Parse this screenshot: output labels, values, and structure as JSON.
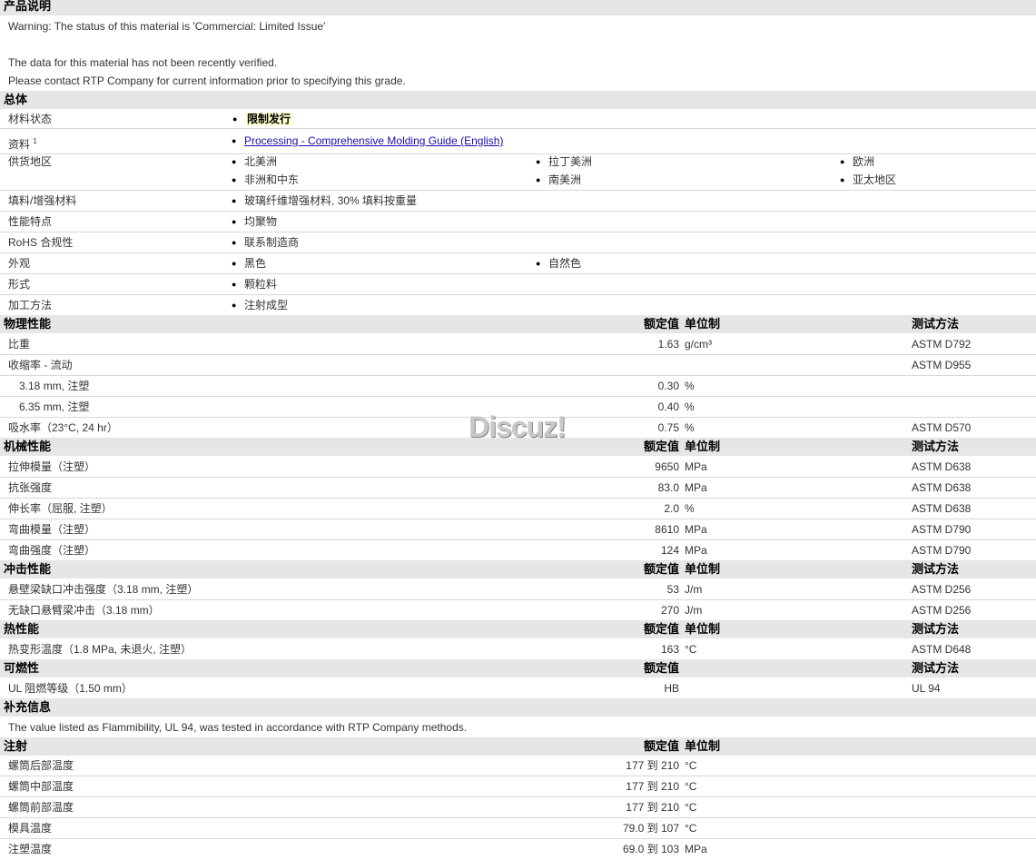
{
  "sections": {
    "desc": "产品说明",
    "general": "总体",
    "physical": "物理性能",
    "mechanical": "机械性能",
    "impact": "冲击性能",
    "thermal": "热性能",
    "flammability": "可燃性",
    "additional": "补充信息",
    "injection": "注射"
  },
  "headers": {
    "value": "额定值",
    "unit": "单位制",
    "method": "测试方法"
  },
  "description": {
    "warning": "Warning: The status of this material is 'Commercial: Limited Issue'",
    "line2": "The data for this material has not been recently verified.",
    "line3": "Please contact RTP Company for current information prior to specifying this grade."
  },
  "general": {
    "status_label": "材料状态",
    "status_value": "限制发行",
    "docs_label": "资料",
    "docs_sup": "1",
    "docs_link": "Processing - Comprehensive Molding Guide (English)",
    "supply_label": "供货地区",
    "supply": [
      "北美洲",
      "拉丁美洲",
      "欧洲",
      "非洲和中东",
      "南美洲",
      "亚太地区"
    ],
    "filler_label": "填料/增强材料",
    "filler_value": "玻璃纤维增强材料, 30% 填料按重量",
    "feature_label": "性能特点",
    "feature_value": "均聚物",
    "rohs_label": "RoHS 合规性",
    "rohs_value": "联系制造商",
    "appearance_label": "外观",
    "appearance": [
      "黑色",
      "自然色"
    ],
    "form_label": "形式",
    "form_value": "颗粒料",
    "process_label": "加工方法",
    "process_value": "注射成型"
  },
  "physical": [
    {
      "label": "比重",
      "value": "1.63",
      "unit": "g/cm³",
      "method": "ASTM D792"
    },
    {
      "label": "收缩率  - 流动",
      "value": "",
      "unit": "",
      "method": "ASTM D955"
    },
    {
      "label": "3.18 mm, 注塑",
      "value": "0.30",
      "unit": "%",
      "method": ""
    },
    {
      "label": "6.35 mm, 注塑",
      "value": "0.40",
      "unit": "%",
      "method": ""
    },
    {
      "label": "吸水率（23°C, 24 hr）",
      "value": "0.75",
      "unit": "%",
      "method": "ASTM D570"
    }
  ],
  "mechanical": [
    {
      "label": "拉伸模量（注塑）",
      "value": "9650",
      "unit": "MPa",
      "method": "ASTM D638"
    },
    {
      "label": "抗张强度",
      "value": "83.0",
      "unit": "MPa",
      "method": "ASTM D638"
    },
    {
      "label": "伸长率（屈服, 注塑）",
      "value": "2.0",
      "unit": "%",
      "method": "ASTM D638"
    },
    {
      "label": "弯曲模量（注塑）",
      "value": "8610",
      "unit": "MPa",
      "method": "ASTM D790"
    },
    {
      "label": "弯曲强度（注塑）",
      "value": "124",
      "unit": "MPa",
      "method": "ASTM D790"
    }
  ],
  "impact": [
    {
      "label": "悬壁梁缺口冲击强度（3.18 mm, 注塑）",
      "value": "53",
      "unit": "J/m",
      "method": "ASTM D256"
    },
    {
      "label": "无缺口悬臂梁冲击（3.18 mm）",
      "value": "270",
      "unit": "J/m",
      "method": "ASTM D256"
    }
  ],
  "thermal": [
    {
      "label": "热变形温度（1.8 MPa, 未退火, 注塑）",
      "value": "163",
      "unit": "°C",
      "method": "ASTM D648"
    }
  ],
  "flammability": [
    {
      "label": "UL 阻燃等级（1.50 mm）",
      "value": "HB",
      "unit": "",
      "method": "UL 94"
    }
  ],
  "additional": {
    "text": "The value listed as Flammibility, UL 94, was tested in accordance with RTP Company methods."
  },
  "injection": [
    {
      "label": "螺筒后部温度",
      "value": "177 到  210",
      "unit": "°C"
    },
    {
      "label": "螺筒中部温度",
      "value": "177 到  210",
      "unit": "°C"
    },
    {
      "label": "螺筒前部温度",
      "value": "177 到  210",
      "unit": "°C"
    },
    {
      "label": "模具温度",
      "value": "79.0 到  107",
      "unit": "°C"
    },
    {
      "label": "注塑温度",
      "value": "69.0 到  103",
      "unit": "MPa"
    }
  ],
  "watermark": "Discuz!"
}
